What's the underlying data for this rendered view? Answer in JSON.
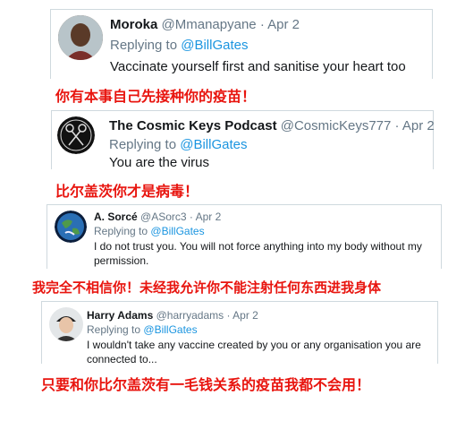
{
  "tweets": [
    {
      "name": "Moroka",
      "handle": "@Mmanapyane",
      "sep": "·",
      "date": "Apr 2",
      "replying_prefix": "Replying to",
      "replying_to": "@BillGates",
      "text": "Vaccinate yourself first and sanitise your heart too",
      "avatar_icon": "person-avatar-icon"
    },
    {
      "name": "The Cosmic Keys Podcast",
      "handle": "@CosmicKeys777",
      "sep": "·",
      "date": "Apr 2",
      "replying_prefix": "Replying to",
      "replying_to": "@BillGates",
      "text": "You are the virus",
      "avatar_icon": "crossed-keys-logo-icon"
    },
    {
      "name": "A. Sorcé",
      "handle": "@ASorc3",
      "sep": "·",
      "date": "Apr 2",
      "replying_prefix": "Replying to",
      "replying_to": "@BillGates",
      "text_line1": "I do not trust you. You will not force anything into my body without my",
      "text_line2": "permission.",
      "avatar_icon": "earth-globe-icon"
    },
    {
      "name": "Harry Adams",
      "handle": "@harryadams",
      "sep": "·",
      "date": "Apr 2",
      "replying_prefix": "Replying to",
      "replying_to": "@BillGates",
      "text_line1": "I wouldn't take any vaccine created by you or any organisation you are",
      "text_line2": "connected to...",
      "avatar_icon": "person-cap-avatar-icon"
    }
  ],
  "captions": [
    "你有本事自己先接种你的疫苗！",
    "比尔盖茨你才是病毒！",
    "我完全不相信你！未经我允许你不能注射任何东西进我身体",
    "只要和你比尔盖茨有一毛钱关系的疫苗我都不会用！"
  ],
  "colors": {
    "caption_red": "#e8150f",
    "link_blue": "#1b95e0",
    "muted_gray": "#657786",
    "border": "#cfd9de"
  }
}
